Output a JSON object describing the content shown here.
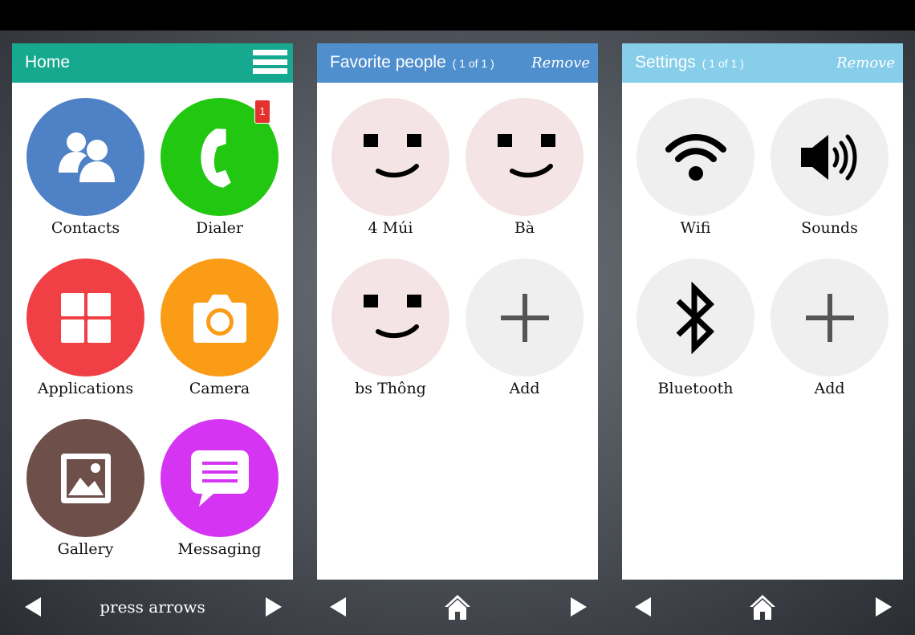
{
  "colors": {
    "home_header": "#17a98f",
    "favorites_header": "#4f8fcd",
    "settings_header": "#87ceea",
    "contacts": "#4e81c5",
    "dialer": "#21c710",
    "applications": "#f04045",
    "camera": "#fb9c17",
    "gallery": "#6e4f4a",
    "messaging": "#d535f2",
    "face_bg": "#f4e4e5",
    "neutral_bg": "#efefef"
  },
  "home": {
    "title": "Home",
    "menu_icon": "hamburger-menu-icon",
    "tiles": [
      {
        "label": "Contacts",
        "icon": "contacts-icon"
      },
      {
        "label": "Dialer",
        "icon": "phone-icon",
        "badge": "1"
      },
      {
        "label": "Applications",
        "icon": "apps-grid-icon"
      },
      {
        "label": "Camera",
        "icon": "camera-icon"
      },
      {
        "label": "Gallery",
        "icon": "gallery-icon"
      },
      {
        "label": "Messaging",
        "icon": "message-icon"
      }
    ],
    "footer_text": "press arrows"
  },
  "favorites": {
    "title": "Favorite people",
    "count": "( 1 of 1 )",
    "remove_label": "Remove",
    "tiles": [
      {
        "label": "4 Múi",
        "icon": "smiley-face-icon"
      },
      {
        "label": "Bà",
        "icon": "smiley-face-icon"
      },
      {
        "label": "bs Thông",
        "icon": "smiley-face-icon"
      },
      {
        "label": "Add",
        "icon": "plus-icon"
      }
    ]
  },
  "settings": {
    "title": "Settings",
    "count": "( 1 of 1 )",
    "remove_label": "Remove",
    "tiles": [
      {
        "label": "Wifi",
        "icon": "wifi-icon"
      },
      {
        "label": "Sounds",
        "icon": "speaker-icon"
      },
      {
        "label": "Bluetooth",
        "icon": "bluetooth-icon"
      },
      {
        "label": "Add",
        "icon": "plus-icon"
      }
    ]
  }
}
